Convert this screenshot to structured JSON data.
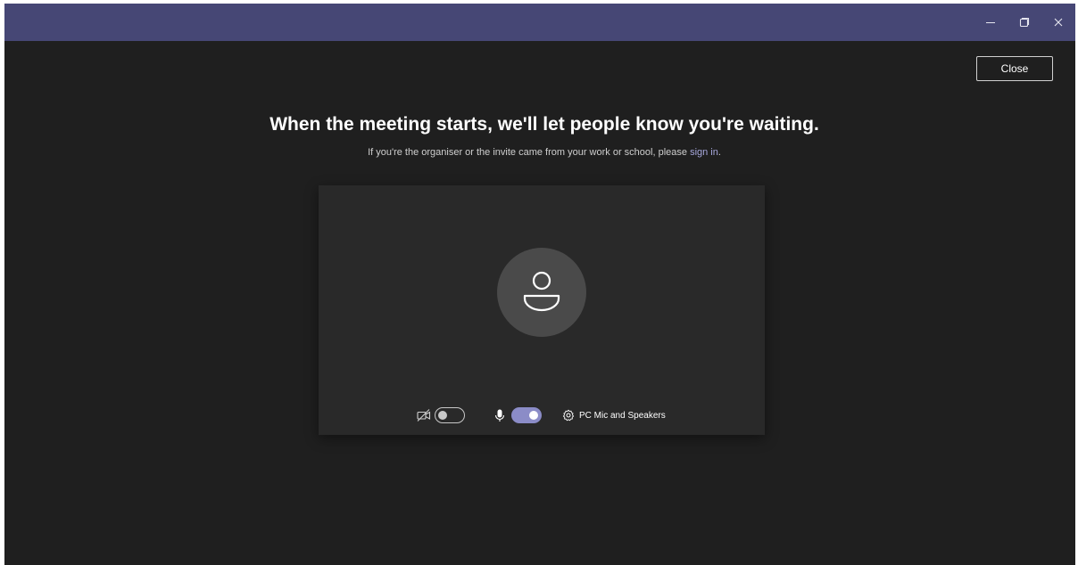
{
  "window": {
    "controls": {
      "minimize": "–",
      "maximize": "❐",
      "close": "✕"
    }
  },
  "close_button": {
    "label": "Close"
  },
  "prejoin": {
    "heading": "When the meeting starts, we'll let people know you're waiting.",
    "subtext_before": "If you're the organiser or the invite came from your work or school, please ",
    "sign_in_link": "sign in",
    "subtext_after": "."
  },
  "controls": {
    "camera": {
      "icon": "camera-off-icon",
      "on": false
    },
    "microphone": {
      "icon": "microphone-icon",
      "on": true
    },
    "device_settings": {
      "icon": "gear-icon",
      "label": "PC Mic and Speakers"
    }
  },
  "colors": {
    "titlebar": "#464775",
    "background": "#1f1f1f",
    "preview": "#292929",
    "accent": "#8b8cc7",
    "link": "#a6a7dc"
  }
}
